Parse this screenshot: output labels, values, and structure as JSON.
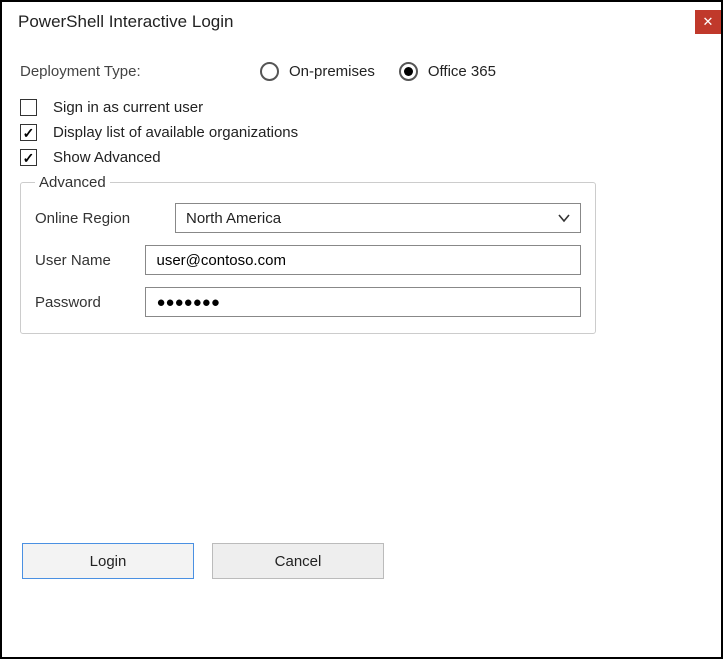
{
  "window": {
    "title": "PowerShell Interactive Login"
  },
  "deployment": {
    "label": "Deployment Type:",
    "options": {
      "onprem": "On-premises",
      "office365": "Office 365"
    },
    "selected": "office365"
  },
  "checkboxes": {
    "signInCurrent": {
      "label": "Sign in as current user",
      "checked": false
    },
    "displayOrgs": {
      "label": "Display list of available organizations",
      "checked": true
    },
    "showAdvanced": {
      "label": "Show Advanced",
      "checked": true
    }
  },
  "advanced": {
    "legend": "Advanced",
    "region": {
      "label": "Online Region",
      "value": "North America"
    },
    "username": {
      "label": "User Name",
      "value": "user@contoso.com"
    },
    "password": {
      "label": "Password",
      "masked": "●●●●●●●"
    }
  },
  "buttons": {
    "login": "Login",
    "cancel": "Cancel"
  }
}
